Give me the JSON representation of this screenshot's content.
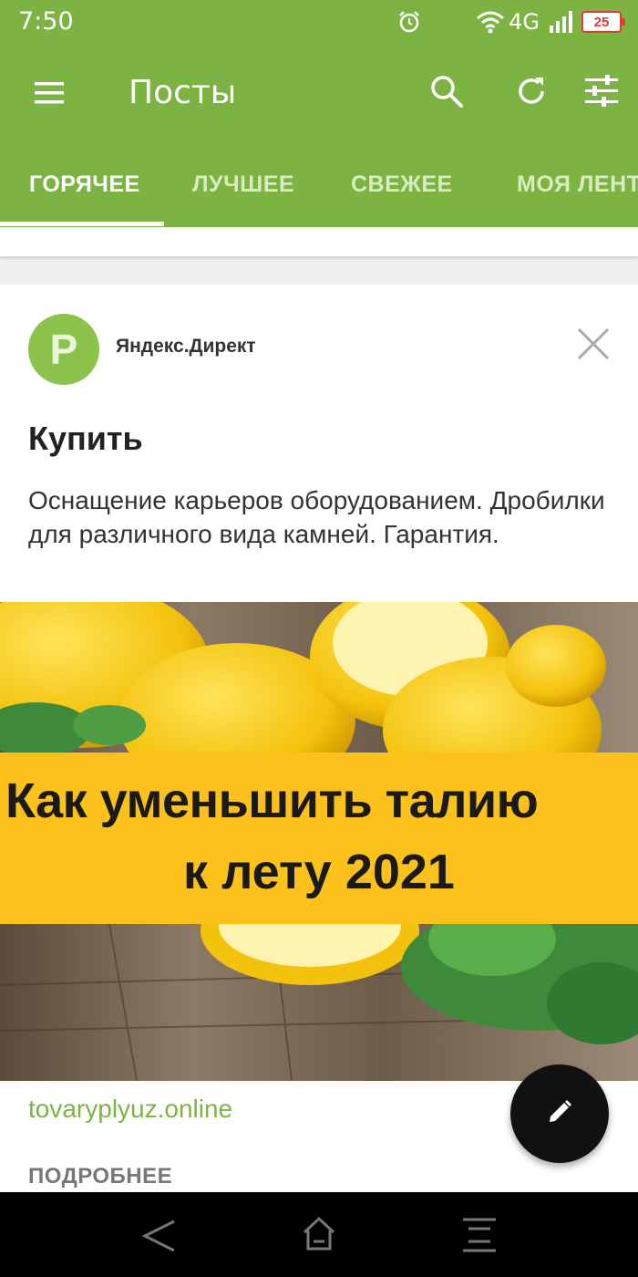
{
  "status_bar": {
    "time": "7:50",
    "network": "4G",
    "battery": "25",
    "battery_color": "#e53935"
  },
  "app_bar": {
    "title": "Посты",
    "background": "#7cb342",
    "icons": [
      "menu-icon",
      "search-icon",
      "refresh-icon",
      "filter-icon"
    ]
  },
  "tabs": [
    {
      "label": "ГОРЯЧЕЕ",
      "active": true
    },
    {
      "label": "ЛУЧШЕЕ",
      "active": false
    },
    {
      "label": "СВЕЖЕЕ",
      "active": false
    },
    {
      "label": "МОЯ ЛЕНТА",
      "active": false
    }
  ],
  "ad": {
    "avatar_letter": "P",
    "source": "Яндекс.Директ",
    "title": "Купить",
    "description": "Оснащение карьеров оборудованием. Дробилки для различного вида камней. Гарантия.",
    "image_banner_line1": "Как уменьшить талию",
    "image_banner_line2": "к лету 2021",
    "link": "tovaryplyuz.online",
    "more": "ПОДРОБНЕЕ",
    "link_color": "#7cb342"
  },
  "fab": {
    "icon": "pencil-icon"
  },
  "nav_bar": {
    "icons": [
      "back-icon",
      "home-icon",
      "recent-apps-icon"
    ]
  }
}
